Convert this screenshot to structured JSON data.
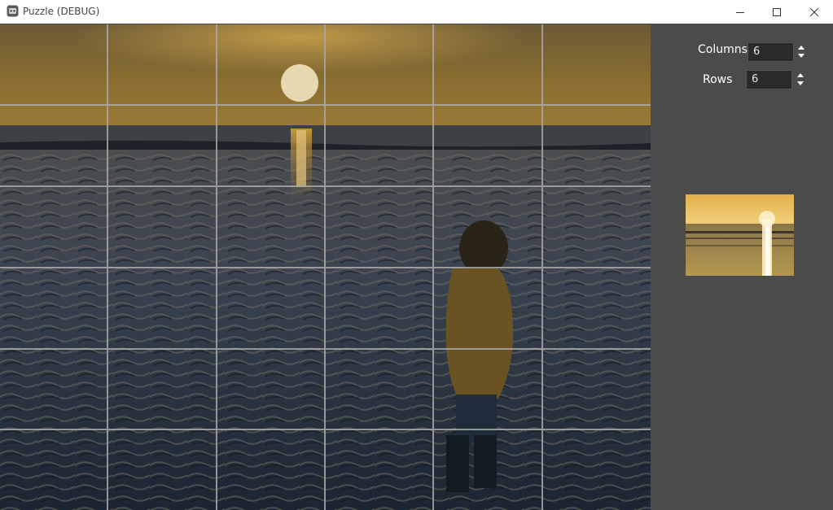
{
  "window": {
    "title": "Puzzle (DEBUG)"
  },
  "controls": {
    "columns_label": "Columns",
    "columns_value": "6",
    "rows_label": "Rows",
    "rows_value": "6"
  },
  "puzzle": {
    "columns": 6,
    "rows": 6
  },
  "icons": [
    "app-icon",
    "minimize-icon",
    "maximize-icon",
    "close-icon",
    "spin-up-icon",
    "spin-down-icon"
  ]
}
